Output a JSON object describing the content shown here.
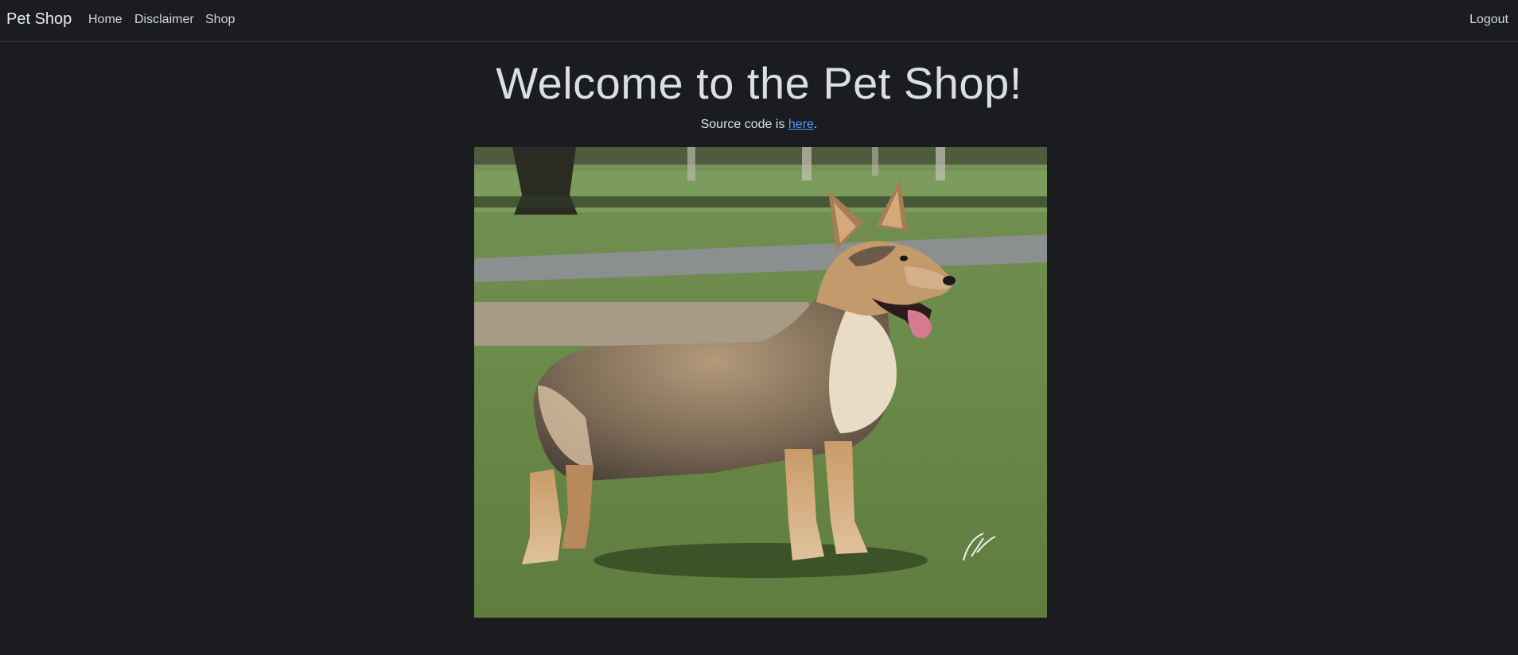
{
  "nav": {
    "brand": "Pet Shop",
    "links": [
      "Home",
      "Disclaimer",
      "Shop"
    ],
    "logout": "Logout"
  },
  "main": {
    "title": "Welcome to the Pet Shop!",
    "source_prefix": "Source code is ",
    "source_link": "here",
    "source_suffix": ".",
    "image_subject": "corgi-dog-photo"
  },
  "colors": {
    "background": "#1a1c1f",
    "link": "#4d9bff"
  }
}
